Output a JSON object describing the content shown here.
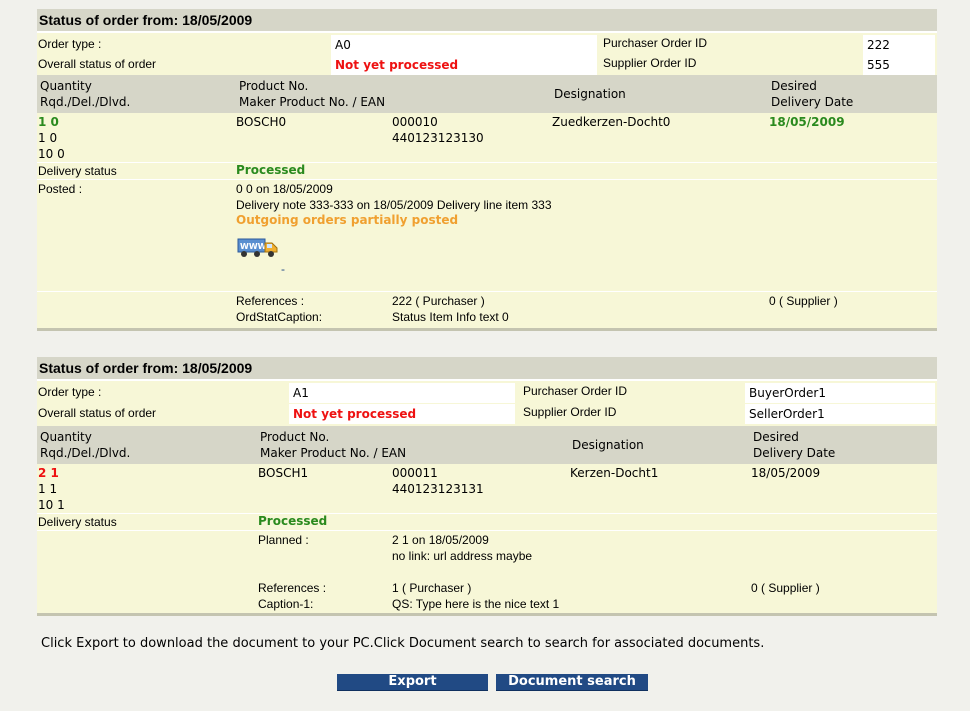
{
  "orders": [
    {
      "title": "Status of order from: 18/05/2009",
      "order_type_label": "Order type :",
      "order_type": "A0",
      "overall_status_label": "Overall status of order",
      "overall_status": "Not yet processed",
      "purchaser_id_label": "Purchaser Order ID",
      "purchaser_id": "222",
      "supplier_id_label": "Supplier Order ID",
      "supplier_id": "555",
      "col_qty": "Quantity",
      "col_qty2": "Rqd./Del./Dlvd.",
      "col_product": "Product No.",
      "col_product2": "Maker Product No. / EAN",
      "col_designation": "Designation",
      "col_date": "Desired",
      "col_date2": "Delivery Date",
      "qty1": "1  0",
      "qty2": "1  0",
      "qty3": "10  0",
      "product": "BOSCH0",
      "maker_no": "000010",
      "ean": "440123123130",
      "designation": "Zuedkerzen-Docht0",
      "delivery_date": "18/05/2009",
      "delivery_status_label": "Delivery status",
      "delivery_status": "Processed",
      "posted_label": "Posted :",
      "posted_line1": "0 0 on 18/05/2009",
      "posted_line2": "Delivery note 333-333 on 18/05/2009 Delivery line item 333",
      "posted_line3": "Outgoing orders partially posted",
      "truck_link": "-",
      "references_label": "References :",
      "references_purchaser": "222 ( Purchaser )",
      "references_supplier": "0 ( Supplier )",
      "caption_label": "OrdStatCaption:",
      "caption_value": "Status Item Info text 0"
    },
    {
      "title": "Status of order from: 18/05/2009",
      "order_type_label": "Order type :",
      "order_type": "A1",
      "overall_status_label": "Overall status of order",
      "overall_status": "Not yet processed",
      "purchaser_id_label": "Purchaser Order ID",
      "purchaser_id": "BuyerOrder1",
      "supplier_id_label": "Supplier Order ID",
      "supplier_id": "SellerOrder1",
      "col_qty": "Quantity",
      "col_qty2": "Rqd./Del./Dlvd.",
      "col_product": "Product No.",
      "col_product2": "Maker Product No. / EAN",
      "col_designation": "Designation",
      "col_date": "Desired",
      "col_date2": "Delivery Date",
      "qty1": "2  1",
      "qty2": "1  1",
      "qty3": "10  1",
      "product": "BOSCH1",
      "maker_no": "000011",
      "ean": "440123123131",
      "designation": "Kerzen-Docht1",
      "delivery_date": "18/05/2009",
      "delivery_status_label": "Delivery status",
      "delivery_status": "Processed",
      "planned_label": "Planned :",
      "planned_line1": "2 1 on 18/05/2009",
      "planned_line2": "no link: url address maybe",
      "references_label": "References :",
      "references_purchaser": "1 ( Purchaser )",
      "references_supplier": "0 ( Supplier )",
      "caption_label": "Caption-1:",
      "caption_value": "QS: Type here is the nice text 1"
    }
  ],
  "info_text": "Click Export to download the document to your PC.Click Document search to search for associated documents.",
  "buttons": {
    "export": "Export",
    "document_search": "Document search"
  },
  "colors": {
    "accent_button": "#214a84",
    "status_red": "#e11111",
    "status_green": "#2a8a1e",
    "status_orange": "#f0a030",
    "header_bg": "#d6d6c8",
    "panel_bg": "#f7f7d7"
  },
  "icons": {
    "truck": "www-delivery-truck-icon"
  }
}
